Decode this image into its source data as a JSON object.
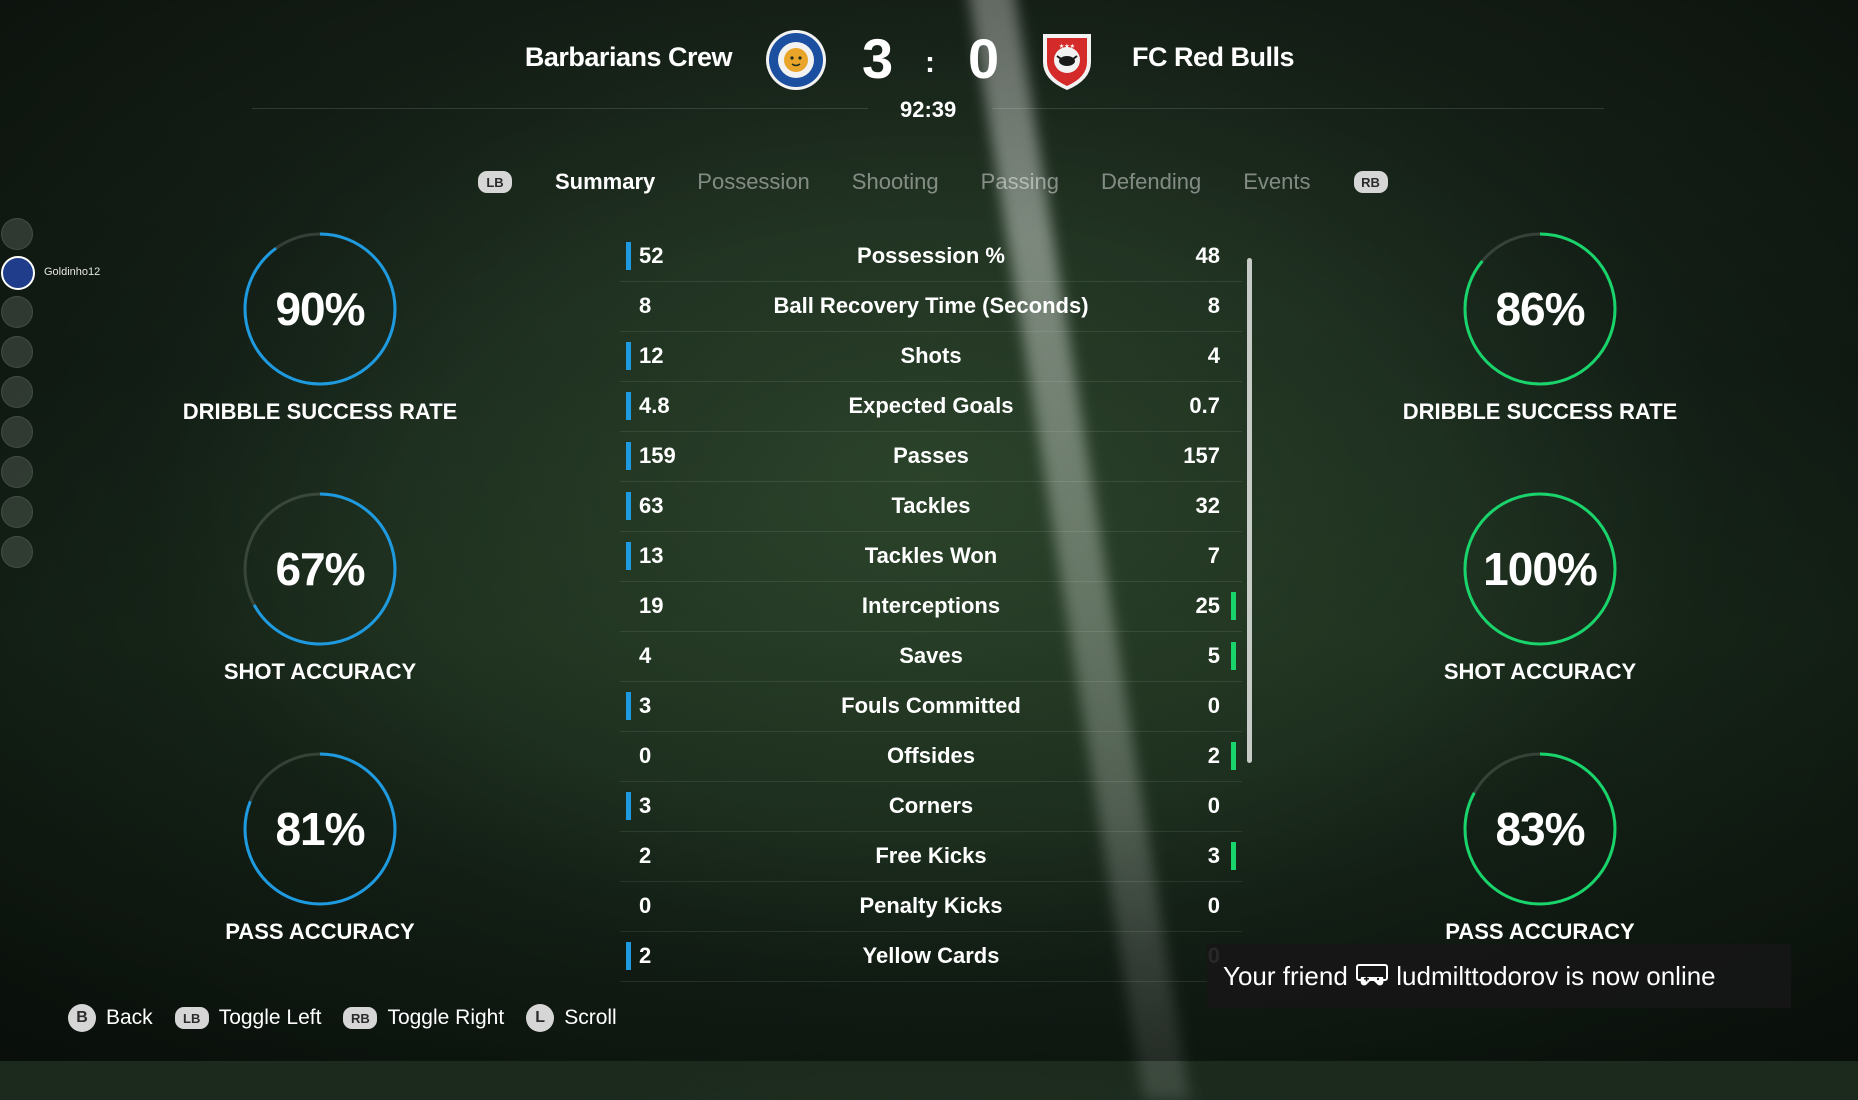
{
  "match": {
    "home_team": "Barbarians Crew",
    "away_team": "FC Red Bulls",
    "home_score": "3",
    "away_score": "0",
    "separator": ":",
    "clock": "92:39",
    "home_color": "#1e9be0",
    "away_color": "#19d36b"
  },
  "tabs": {
    "left_button": "LB",
    "right_button": "RB",
    "items": [
      {
        "label": "Summary",
        "active": true
      },
      {
        "label": "Possession",
        "active": false
      },
      {
        "label": "Shooting",
        "active": false
      },
      {
        "label": "Passing",
        "active": false
      },
      {
        "label": "Defending",
        "active": false
      },
      {
        "label": "Events",
        "active": false
      }
    ]
  },
  "friends": {
    "active_friend": "Goldinho12"
  },
  "home_rings": [
    {
      "value": "90%",
      "fraction": 0.9,
      "label": "DRIBBLE SUCCESS RATE"
    },
    {
      "value": "67%",
      "fraction": 0.67,
      "label": "SHOT ACCURACY"
    },
    {
      "value": "81%",
      "fraction": 0.81,
      "label": "PASS ACCURACY"
    }
  ],
  "away_rings": [
    {
      "value": "86%",
      "fraction": 0.86,
      "label": "DRIBBLE SUCCESS RATE"
    },
    {
      "value": "100%",
      "fraction": 1.0,
      "label": "SHOT ACCURACY"
    },
    {
      "value": "83%",
      "fraction": 0.83,
      "label": "PASS ACCURACY"
    }
  ],
  "stats": [
    {
      "name": "Possession %",
      "home": "52",
      "away": "48",
      "lead": "home"
    },
    {
      "name": "Ball Recovery Time (Seconds)",
      "home": "8",
      "away": "8",
      "lead": "none"
    },
    {
      "name": "Shots",
      "home": "12",
      "away": "4",
      "lead": "home"
    },
    {
      "name": "Expected Goals",
      "home": "4.8",
      "away": "0.7",
      "lead": "home"
    },
    {
      "name": "Passes",
      "home": "159",
      "away": "157",
      "lead": "home"
    },
    {
      "name": "Tackles",
      "home": "63",
      "away": "32",
      "lead": "home"
    },
    {
      "name": "Tackles Won",
      "home": "13",
      "away": "7",
      "lead": "home"
    },
    {
      "name": "Interceptions",
      "home": "19",
      "away": "25",
      "lead": "away"
    },
    {
      "name": "Saves",
      "home": "4",
      "away": "5",
      "lead": "away"
    },
    {
      "name": "Fouls Committed",
      "home": "3",
      "away": "0",
      "lead": "home"
    },
    {
      "name": "Offsides",
      "home": "0",
      "away": "2",
      "lead": "away"
    },
    {
      "name": "Corners",
      "home": "3",
      "away": "0",
      "lead": "home"
    },
    {
      "name": "Free Kicks",
      "home": "2",
      "away": "3",
      "lead": "away"
    },
    {
      "name": "Penalty Kicks",
      "home": "0",
      "away": "0",
      "lead": "none"
    },
    {
      "name": "Yellow Cards",
      "home": "2",
      "away": "0",
      "lead": "home"
    }
  ],
  "footer": {
    "back_key": "B",
    "back_label": "Back",
    "toggle_left_key": "LB",
    "toggle_left_label": "Toggle Left",
    "toggle_right_key": "RB",
    "toggle_right_label": "Toggle Right",
    "scroll_key": "L",
    "scroll_label": "Scroll"
  },
  "toast": {
    "prefix": "Your friend ",
    "suffix": " ludmilttodorov is now online",
    "icon": "gamepad-icon"
  }
}
